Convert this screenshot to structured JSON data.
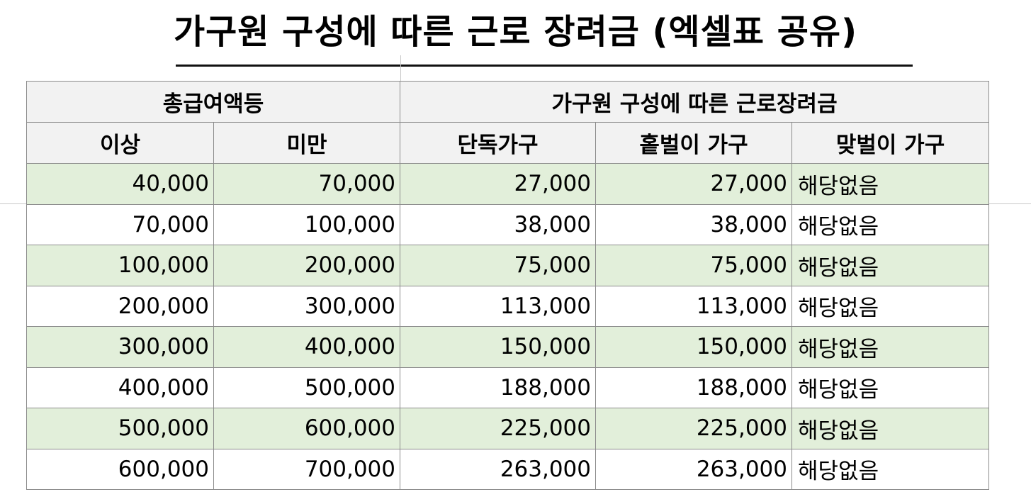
{
  "title": "가구원 구성에 따른 근로 장려금 (엑셀표 공유)",
  "table": {
    "group_headers": {
      "income": "총급여액등",
      "incentive": "가구원 구성에 따른 근로장려금"
    },
    "column_headers": [
      "이상",
      "미만",
      "단독가구",
      "홑벌이 가구",
      "맞벌이 가구"
    ],
    "rows": [
      [
        "40,000",
        "70,000",
        "27,000",
        "27,000",
        "해당없음"
      ],
      [
        "70,000",
        "100,000",
        "38,000",
        "38,000",
        "해당없음"
      ],
      [
        "100,000",
        "200,000",
        "75,000",
        "75,000",
        "해당없음"
      ],
      [
        "200,000",
        "300,000",
        "113,000",
        "113,000",
        "해당없음"
      ],
      [
        "300,000",
        "400,000",
        "150,000",
        "150,000",
        "해당없음"
      ],
      [
        "400,000",
        "500,000",
        "188,000",
        "188,000",
        "해당없음"
      ],
      [
        "500,000",
        "600,000",
        "225,000",
        "225,000",
        "해당없음"
      ],
      [
        "600,000",
        "700,000",
        "263,000",
        "263,000",
        "해당없음"
      ]
    ],
    "colors": {
      "header_bg": "#f2f2f2",
      "shaded_row_bg": "#e2efda",
      "plain_row_bg": "#ffffff",
      "border": "#8c8c8c"
    }
  }
}
